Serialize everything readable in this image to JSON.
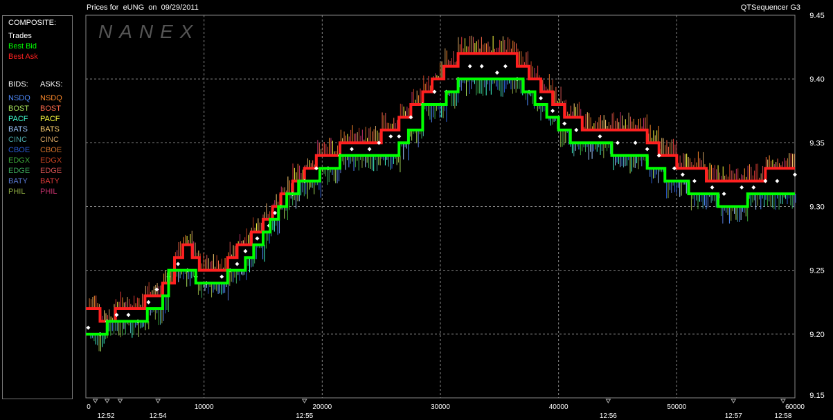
{
  "header": {
    "title": "Prices for  eUNG  on  09/29/2011",
    "app": "QTSequencer G3"
  },
  "legend": {
    "composite_title": "COMPOSITE:",
    "composite": [
      {
        "label": "Trades",
        "color": "#ffffff"
      },
      {
        "label": "Best Bid",
        "color": "#00ff00"
      },
      {
        "label": "Best Ask",
        "color": "#ff2020"
      }
    ],
    "bids_title": "BIDS:",
    "asks_title": "ASKS:",
    "bids": [
      {
        "label": "NSDQ",
        "color": "#4f8cff"
      },
      {
        "label": "BOST",
        "color": "#a6e05a"
      },
      {
        "label": "PACF",
        "color": "#40ffd0"
      },
      {
        "label": "BATS",
        "color": "#9ec8ff"
      },
      {
        "label": "CINC",
        "color": "#4aa6a6"
      },
      {
        "label": "CBOE",
        "color": "#2a5cd6"
      },
      {
        "label": "EDGX",
        "color": "#3aa63a"
      },
      {
        "label": "EDGE",
        "color": "#3aa65a"
      },
      {
        "label": "BATY",
        "color": "#5a7ad6"
      },
      {
        "label": "PHIL",
        "color": "#8aa640"
      }
    ],
    "asks": [
      {
        "label": "NSDQ",
        "color": "#ff8a2a"
      },
      {
        "label": "BOST",
        "color": "#ff6a4a"
      },
      {
        "label": "PACF",
        "color": "#ffff40"
      },
      {
        "label": "BATS",
        "color": "#ffd070"
      },
      {
        "label": "CINC",
        "color": "#d0a060"
      },
      {
        "label": "CBOE",
        "color": "#d0702a"
      },
      {
        "label": "EDGX",
        "color": "#c04020"
      },
      {
        "label": "EDGE",
        "color": "#d05050"
      },
      {
        "label": "BATY",
        "color": "#e03a3a"
      },
      {
        "label": "PHIL",
        "color": "#c0306a"
      }
    ]
  },
  "watermark": "NANEX",
  "chart_data": {
    "type": "line",
    "xlim": [
      0,
      60000
    ],
    "ylim": [
      9.15,
      9.45
    ],
    "grid": true,
    "x_ticks": [
      0,
      10000,
      20000,
      30000,
      40000,
      50000,
      60000
    ],
    "y_ticks": [
      9.2,
      9.25,
      9.3,
      9.35,
      9.4,
      9.45
    ],
    "y_tick_labels": [
      "9.20",
      "9.25",
      "9.30",
      "9.35",
      "9.40",
      "9.45"
    ],
    "y_extra_labels": [
      {
        "value": 9.15,
        "label": "9.15"
      }
    ],
    "time_labels": [
      {
        "x": 1700,
        "label": "12:52"
      },
      {
        "x": 6100,
        "label": "12:54"
      },
      {
        "x": 18500,
        "label": "12:55"
      },
      {
        "x": 44200,
        "label": "12:56"
      },
      {
        "x": 54800,
        "label": "12:57"
      },
      {
        "x": 59000,
        "label": "12:58"
      }
    ],
    "time_markers": [
      800,
      1800,
      2900,
      6100,
      18500,
      44200,
      54800,
      59000
    ],
    "series": [
      {
        "name": "Best Ask",
        "color": "#ff2020",
        "points": [
          [
            0,
            9.22
          ],
          [
            1200,
            9.21
          ],
          [
            2500,
            9.22
          ],
          [
            4500,
            9.22
          ],
          [
            5000,
            9.23
          ],
          [
            6500,
            9.24
          ],
          [
            7500,
            9.26
          ],
          [
            8200,
            9.27
          ],
          [
            9000,
            9.26
          ],
          [
            9600,
            9.25
          ],
          [
            11500,
            9.25
          ],
          [
            12000,
            9.26
          ],
          [
            12800,
            9.27
          ],
          [
            14000,
            9.28
          ],
          [
            15000,
            9.29
          ],
          [
            15800,
            9.3
          ],
          [
            16500,
            9.31
          ],
          [
            17500,
            9.32
          ],
          [
            18500,
            9.33
          ],
          [
            19500,
            9.34
          ],
          [
            20500,
            9.34
          ],
          [
            21500,
            9.35
          ],
          [
            23000,
            9.35
          ],
          [
            25000,
            9.36
          ],
          [
            26500,
            9.37
          ],
          [
            27500,
            9.38
          ],
          [
            28500,
            9.39
          ],
          [
            29300,
            9.4
          ],
          [
            30300,
            9.41
          ],
          [
            31500,
            9.42
          ],
          [
            33000,
            9.42
          ],
          [
            35500,
            9.42
          ],
          [
            36500,
            9.41
          ],
          [
            37500,
            9.4
          ],
          [
            38500,
            9.39
          ],
          [
            39500,
            9.38
          ],
          [
            40500,
            9.37
          ],
          [
            42000,
            9.36
          ],
          [
            44500,
            9.36
          ],
          [
            46500,
            9.36
          ],
          [
            47500,
            9.35
          ],
          [
            48500,
            9.34
          ],
          [
            50000,
            9.33
          ],
          [
            51000,
            9.33
          ],
          [
            52500,
            9.32
          ],
          [
            54500,
            9.32
          ],
          [
            56000,
            9.32
          ],
          [
            57500,
            9.33
          ],
          [
            60000,
            9.33
          ]
        ]
      },
      {
        "name": "Trades",
        "color": "#ffffff",
        "points": [
          [
            200,
            9.205
          ],
          [
            1200,
            9.2
          ],
          [
            1800,
            9.21
          ],
          [
            2600,
            9.215
          ],
          [
            3600,
            9.215
          ],
          [
            4400,
            9.21
          ],
          [
            5300,
            9.225
          ],
          [
            6000,
            9.235
          ],
          [
            7000,
            9.245
          ],
          [
            7800,
            9.255
          ],
          [
            8600,
            9.25
          ],
          [
            9300,
            9.245
          ],
          [
            10200,
            9.24
          ],
          [
            11500,
            9.245
          ],
          [
            12200,
            9.25
          ],
          [
            12800,
            9.255
          ],
          [
            13500,
            9.265
          ],
          [
            14500,
            9.275
          ],
          [
            15500,
            9.285
          ],
          [
            16000,
            9.295
          ],
          [
            16500,
            9.3
          ],
          [
            17500,
            9.31
          ],
          [
            18500,
            9.32
          ],
          [
            19500,
            9.33
          ],
          [
            20500,
            9.33
          ],
          [
            21500,
            9.34
          ],
          [
            22500,
            9.345
          ],
          [
            24000,
            9.345
          ],
          [
            24800,
            9.35
          ],
          [
            25800,
            9.355
          ],
          [
            26500,
            9.355
          ],
          [
            27500,
            9.37
          ],
          [
            28500,
            9.38
          ],
          [
            29500,
            9.39
          ],
          [
            30500,
            9.39
          ],
          [
            31500,
            9.4
          ],
          [
            32500,
            9.41
          ],
          [
            33500,
            9.41
          ],
          [
            34800,
            9.405
          ],
          [
            35500,
            9.41
          ],
          [
            36500,
            9.4
          ],
          [
            37500,
            9.39
          ],
          [
            38500,
            9.385
          ],
          [
            39500,
            9.375
          ],
          [
            40500,
            9.365
          ],
          [
            41500,
            9.36
          ],
          [
            43500,
            9.355
          ],
          [
            45000,
            9.35
          ],
          [
            46500,
            9.35
          ],
          [
            47500,
            9.345
          ],
          [
            48500,
            9.34
          ],
          [
            49800,
            9.33
          ],
          [
            50500,
            9.325
          ],
          [
            51500,
            9.32
          ],
          [
            53000,
            9.315
          ],
          [
            54000,
            9.31
          ],
          [
            55500,
            9.315
          ],
          [
            56500,
            9.315
          ],
          [
            57500,
            9.32
          ],
          [
            58500,
            9.32
          ],
          [
            60000,
            9.325
          ]
        ]
      },
      {
        "name": "Best Bid",
        "color": "#00ff00",
        "points": [
          [
            0,
            9.2
          ],
          [
            1300,
            9.2
          ],
          [
            1800,
            9.21
          ],
          [
            4500,
            9.21
          ],
          [
            5200,
            9.22
          ],
          [
            6500,
            9.23
          ],
          [
            7000,
            9.25
          ],
          [
            8500,
            9.25
          ],
          [
            9300,
            9.24
          ],
          [
            11500,
            9.24
          ],
          [
            12000,
            9.25
          ],
          [
            13500,
            9.26
          ],
          [
            14200,
            9.27
          ],
          [
            15000,
            9.28
          ],
          [
            15600,
            9.29
          ],
          [
            16300,
            9.3
          ],
          [
            17000,
            9.31
          ],
          [
            18000,
            9.32
          ],
          [
            19000,
            9.32
          ],
          [
            19800,
            9.33
          ],
          [
            20800,
            9.33
          ],
          [
            21500,
            9.34
          ],
          [
            22500,
            9.34
          ],
          [
            25500,
            9.34
          ],
          [
            26500,
            9.35
          ],
          [
            27300,
            9.36
          ],
          [
            28500,
            9.38
          ],
          [
            29500,
            9.38
          ],
          [
            30500,
            9.39
          ],
          [
            31500,
            9.4
          ],
          [
            34500,
            9.4
          ],
          [
            36000,
            9.4
          ],
          [
            37000,
            9.39
          ],
          [
            38000,
            9.38
          ],
          [
            39000,
            9.37
          ],
          [
            40000,
            9.36
          ],
          [
            41000,
            9.35
          ],
          [
            42500,
            9.35
          ],
          [
            44500,
            9.34
          ],
          [
            46500,
            9.34
          ],
          [
            47500,
            9.33
          ],
          [
            49000,
            9.32
          ],
          [
            50000,
            9.32
          ],
          [
            51000,
            9.31
          ],
          [
            52500,
            9.31
          ],
          [
            53500,
            9.3
          ],
          [
            55000,
            9.3
          ],
          [
            56000,
            9.31
          ],
          [
            60000,
            9.31
          ]
        ]
      }
    ]
  }
}
